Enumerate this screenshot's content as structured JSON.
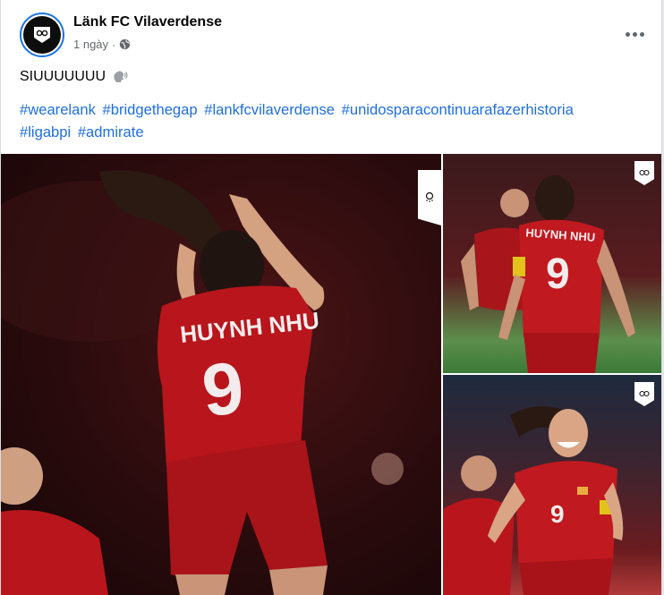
{
  "post": {
    "page_name": "Länk FC Vilaverdense",
    "time": "1 ngày",
    "separator": "·",
    "caption": "SIUUUUUUU",
    "hashtags": [
      "#wearelank",
      "#bridgethegap",
      "#lankfcvilaverdense",
      "#unidosparacontinuarafazerhistoria",
      "#ligabpi",
      "#admirate"
    ]
  },
  "photos": {
    "main": {
      "jersey_name": "HUYNH NHU",
      "jersey_number": "9"
    },
    "top": {
      "jersey_name": "HUYNH NHU",
      "jersey_number": "9"
    },
    "bottom": {
      "jersey_number": "9"
    }
  },
  "colors": {
    "link": "#216fdb",
    "muted": "#65676b",
    "jersey": "#b8161c",
    "avatar_ring": "#1b74e4"
  },
  "icons": {
    "avatar": "club-crest-icon",
    "privacy": "globe-icon",
    "more": "more-options-icon",
    "caption_emoji": "speaking-head-icon",
    "watermark": "club-crest-icon"
  }
}
